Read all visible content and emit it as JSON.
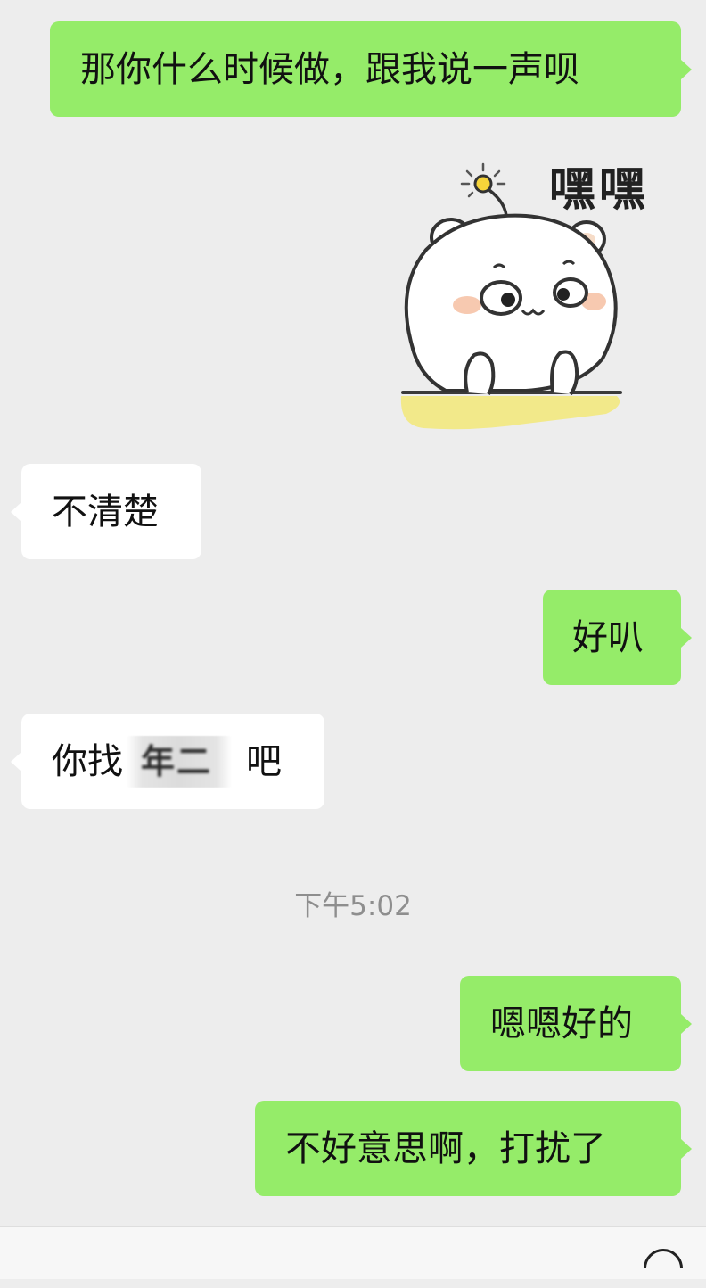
{
  "messages": [
    {
      "side": "me",
      "text": "那你什么时候做，跟我说一声呗"
    },
    {
      "side": "me",
      "type": "sticker",
      "caption": "嘿嘿"
    },
    {
      "side": "them",
      "text": "不清楚"
    },
    {
      "side": "me",
      "text": "好叭"
    },
    {
      "side": "them",
      "text_before": "你找",
      "redacted": "年二",
      "text_after": "吧"
    },
    {
      "side": "me",
      "text": "嗯嗯好的"
    },
    {
      "side": "me",
      "text": "不好意思啊，打扰了"
    }
  ],
  "timestamp": "下午5:02",
  "colors": {
    "me_bubble": "#95ec69",
    "them_bubble": "#ffffff",
    "background": "#ededed",
    "sticker_ground": "#f2e98a"
  },
  "icons": {
    "sticker": "hamster-peeking-sticker",
    "bottom_right": "more-icon"
  }
}
